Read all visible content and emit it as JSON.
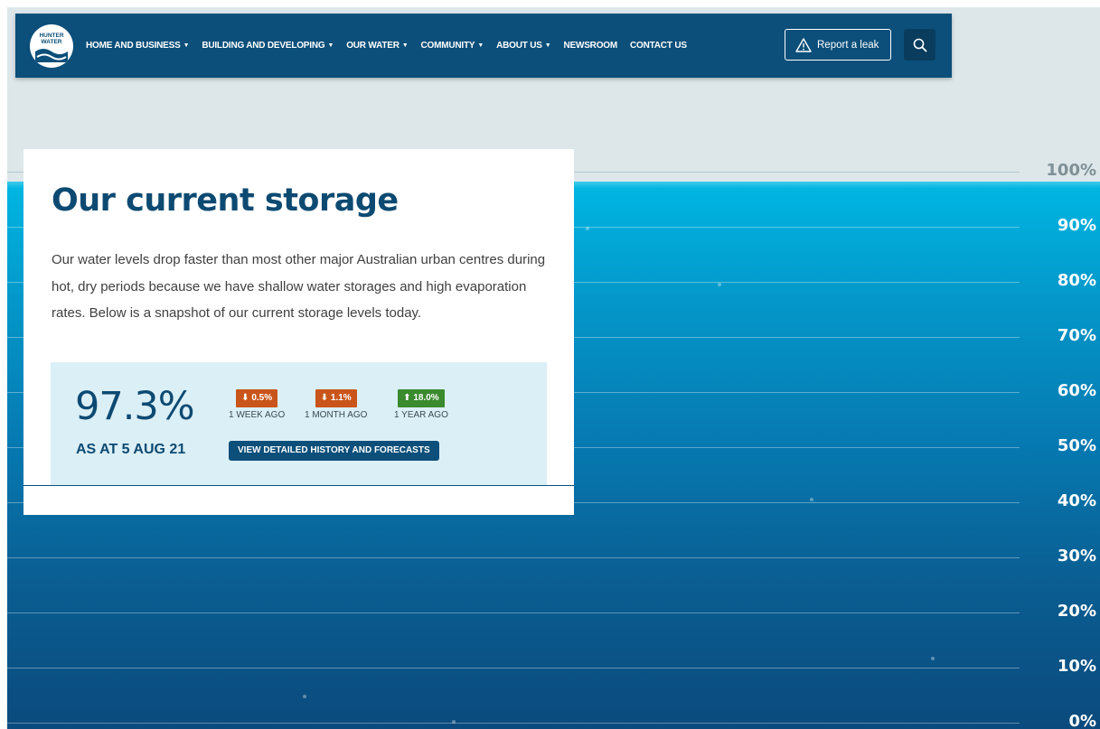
{
  "header": {
    "logo_text_line1": "HUNTER",
    "logo_text_line2": "WATER",
    "nav": [
      {
        "label": "HOME AND BUSINESS",
        "has_dropdown": true
      },
      {
        "label": "BUILDING AND DEVELOPING",
        "has_dropdown": true
      },
      {
        "label": "OUR WATER",
        "has_dropdown": true
      },
      {
        "label": "COMMUNITY",
        "has_dropdown": true
      },
      {
        "label": "ABOUT US",
        "has_dropdown": true
      },
      {
        "label": "NEWSROOM",
        "has_dropdown": false
      },
      {
        "label": "CONTACT US",
        "has_dropdown": false
      }
    ],
    "report_label": "Report a leak",
    "report_icon": "warning-triangle-icon",
    "search_icon": "search-icon"
  },
  "storage": {
    "title": "Our current storage",
    "description": "Our water levels drop faster than most other major Australian urban centres during hot, dry periods because we have shallow water storages and high evaporation rates. Below is a snapshot of our current storage levels today.",
    "level": "97.3%",
    "level_fraction": 0.973,
    "as_at": "AS AT 5 AUG 21",
    "changes": [
      {
        "value": "0.5%",
        "direction": "down",
        "label": "1 WEEK AGO"
      },
      {
        "value": "1.1%",
        "direction": "down",
        "label": "1 MONTH AGO"
      },
      {
        "value": "18.0%",
        "direction": "up",
        "label": "1 YEAR AGO"
      }
    ],
    "history_button": "VIEW DETAILED HISTORY AND FORECASTS"
  },
  "scale": [
    "100%",
    "90%",
    "80%",
    "70%",
    "60%",
    "50%",
    "40%",
    "30%",
    "20%",
    "10%",
    "0%"
  ],
  "colors": {
    "brand_navy": "#0b4f7a",
    "water_top": "#00b7e3",
    "water_bottom": "#0b4a7d",
    "down_badge": "#c9551a",
    "up_badge": "#3a8a2e"
  }
}
